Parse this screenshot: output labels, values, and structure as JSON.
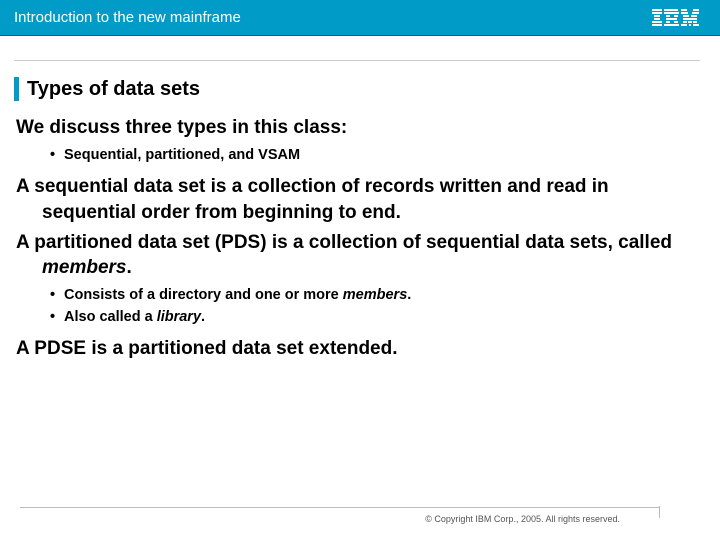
{
  "header": {
    "title": "Introduction to the new mainframe"
  },
  "section": {
    "title": "Types of data sets"
  },
  "content": {
    "intro": "We discuss three types in this class:",
    "intro_bullet": "Sequential, partitioned, and VSAM",
    "para_sequential": "A sequential data set is a collection of records written and read in sequential order from beginning to end.",
    "para_partitioned_pre": "A partitioned data set (PDS) is a collection of sequential data sets, called ",
    "para_partitioned_em": "members",
    "para_partitioned_post": ".",
    "pds_bullets": {
      "b1_pre": "Consists of a directory and one or more ",
      "b1_em": "members",
      "b1_post": ".",
      "b2_pre": "Also called a ",
      "b2_em": "library",
      "b2_post": "."
    },
    "para_pdse": "A PDSE is a partitioned data set extended."
  },
  "footer": {
    "copyright": "© Copyright IBM Corp., 2005. All rights reserved."
  }
}
